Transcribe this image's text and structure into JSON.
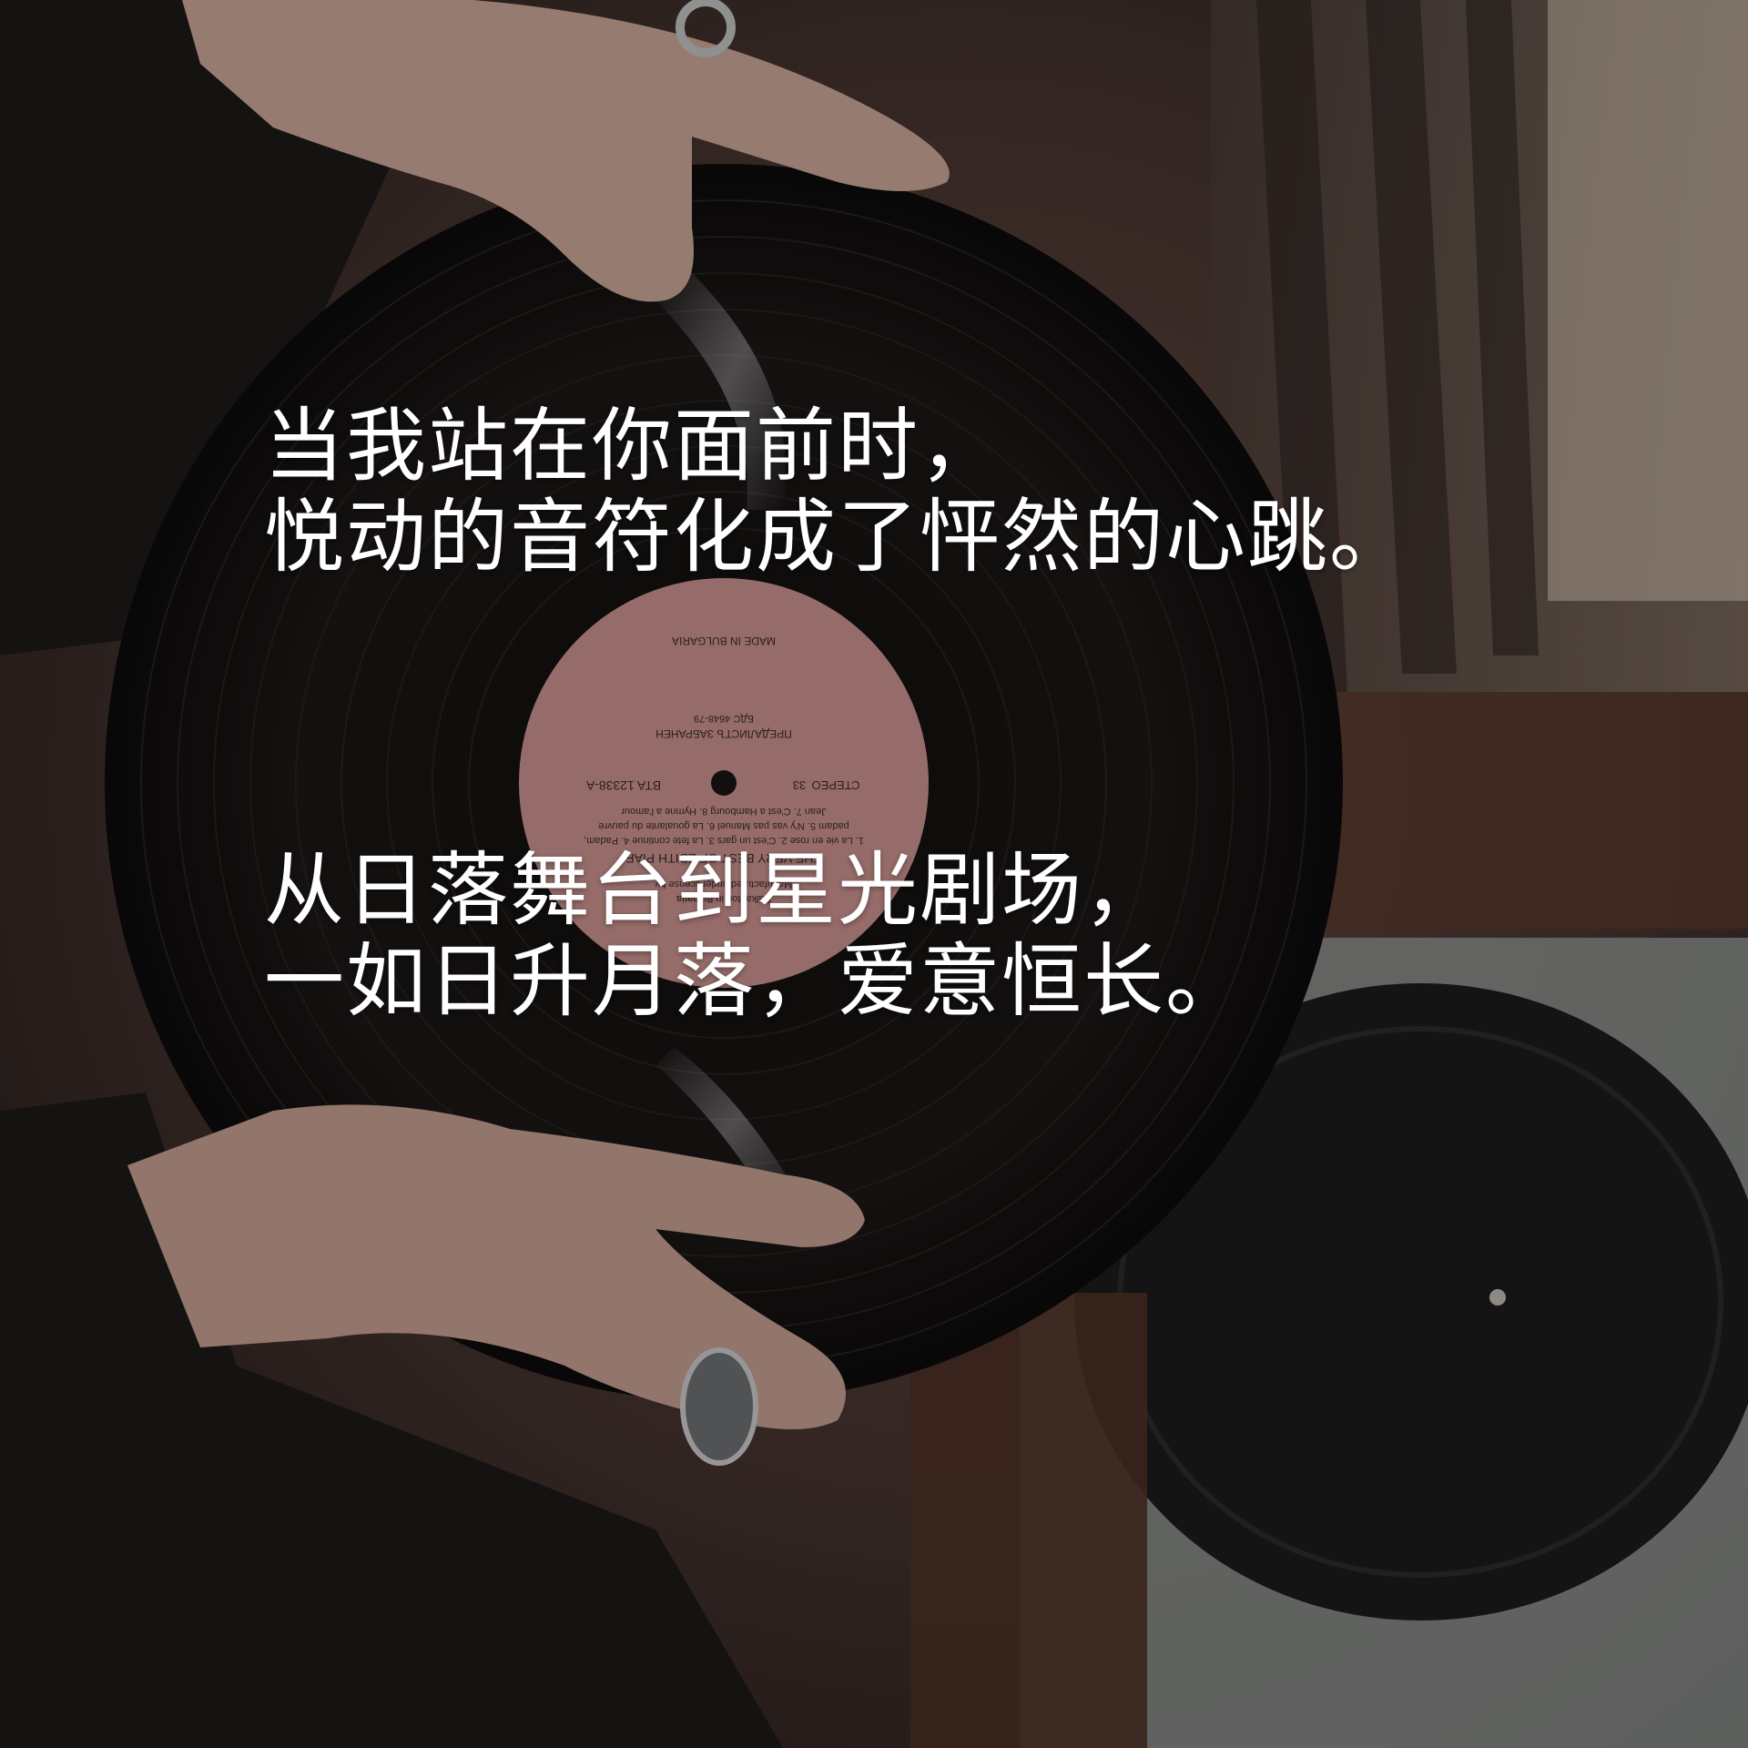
{
  "poem": {
    "line1": "当我站在你面前时，",
    "line2": "悦动的音符化成了怦然的心跳。",
    "line3": "从日落舞台到星光剧场，",
    "line4": "一如日升月落，爱意恒长。"
  },
  "label": {
    "catalog": "BTA 12338-A",
    "title": "THE VERY BEST OF EDITH PIAF",
    "tracks_1": "1. La vie en rose  2. C'est un gars  3. La fete continue  4. Padam,",
    "tracks_2": "padam  5. N'y vas pas Manuel  6. La goualante du pauvre",
    "tracks_3": "Jean  7. C'est a Hambourg  8. Hymne a l'amour",
    "license": "Manufactured under license by",
    "licensor": "Balkanton in Bulgaria",
    "stereo": "СТЕРЕО",
    "speed": "33",
    "cyr_1": "ПРЕДАЛИСТЪ ЗАБРАНЕН",
    "cyr_2": "БДС 4648-79",
    "made_in": "MADE IN BULGARIA"
  },
  "colors": {
    "label_pink": "#c7918d",
    "vinyl": "#141110",
    "text": "#ffffff"
  }
}
